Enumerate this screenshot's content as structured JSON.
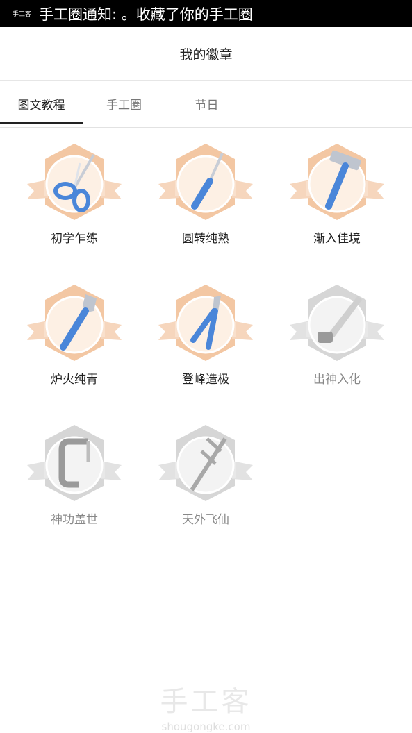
{
  "notification": {
    "app_logo": "手工客",
    "text": "手工圈通知: 。收藏了你的手工圈"
  },
  "header": {
    "title": "我的徽章"
  },
  "tabs": [
    {
      "label": "图文教程",
      "active": true
    },
    {
      "label": "手工圈",
      "active": false
    },
    {
      "label": "节日",
      "active": false
    }
  ],
  "badges": [
    {
      "label": "初学乍练",
      "icon": "scissors-icon",
      "unlocked": true
    },
    {
      "label": "圆转纯熟",
      "icon": "screwdriver-icon",
      "unlocked": true
    },
    {
      "label": "渐入佳境",
      "icon": "hammer-icon",
      "unlocked": true
    },
    {
      "label": "炉火纯青",
      "icon": "wrench-icon",
      "unlocked": true
    },
    {
      "label": "登峰造极",
      "icon": "pliers-icon",
      "unlocked": true
    },
    {
      "label": "出神入化",
      "icon": "saw-icon",
      "unlocked": false
    },
    {
      "label": "神功盖世",
      "icon": "clamp-icon",
      "unlocked": false
    },
    {
      "label": "天外飞仙",
      "icon": "caliper-icon",
      "unlocked": false
    }
  ],
  "colors": {
    "unlocked_ribbon": "#f6d6bd",
    "unlocked_hex": "#f3c7a3",
    "unlocked_circle": "#fdf0e4",
    "tool_blue": "#4a86d9",
    "locked_gray": "#cfcfcf"
  },
  "watermark": {
    "main": "手工客",
    "sub": "shougongke.com"
  }
}
